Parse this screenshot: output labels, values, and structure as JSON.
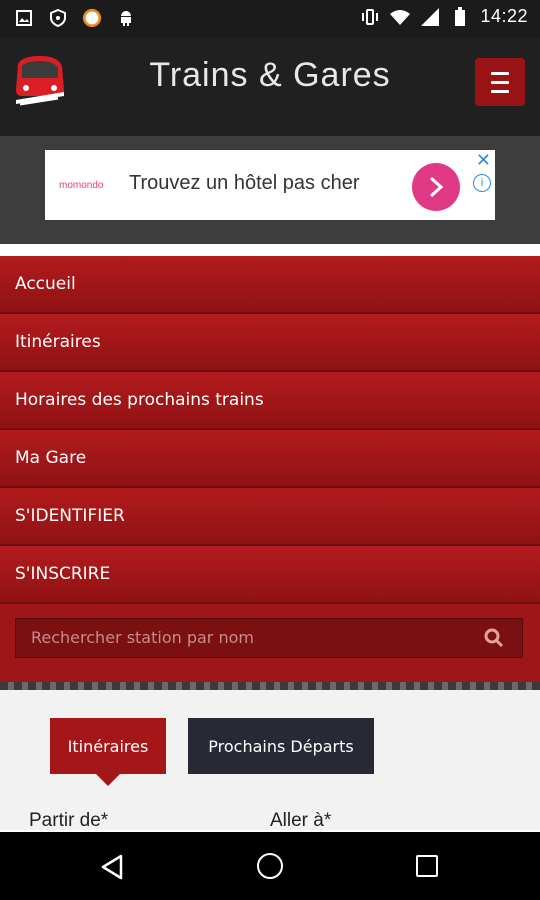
{
  "status_bar": {
    "time": "14:22",
    "icons": [
      "image-icon",
      "shield-icon",
      "qr-badge-icon",
      "android-icon",
      "vibrate-icon",
      "wifi-icon",
      "signal-icon",
      "battery-icon"
    ]
  },
  "app_bar": {
    "title": "Trains & Gares",
    "logo": "train-logo-icon",
    "menu_icon": "hamburger-icon"
  },
  "ad": {
    "brand": "momondo",
    "text": "Trouvez un hôtel pas cher",
    "cta_icon": "chevron-right-icon"
  },
  "nav_menu": {
    "items": [
      {
        "label": "Accueil"
      },
      {
        "label": "Itinéraires"
      },
      {
        "label": "Horaires des prochains trains"
      },
      {
        "label": "Ma Gare"
      },
      {
        "label": "S'IDENTIFIER"
      },
      {
        "label": "S'INSCRIRE"
      }
    ]
  },
  "search": {
    "placeholder": "Rechercher station par nom"
  },
  "tabs": {
    "itineraires": "Itinéraires",
    "prochains_departs": "Prochains Départs"
  },
  "form": {
    "from_label": "Partir de*",
    "to_label": "Aller à*"
  },
  "colors": {
    "accent": "#a51619",
    "appbar": "#202020",
    "dark_tab": "#272a35"
  }
}
